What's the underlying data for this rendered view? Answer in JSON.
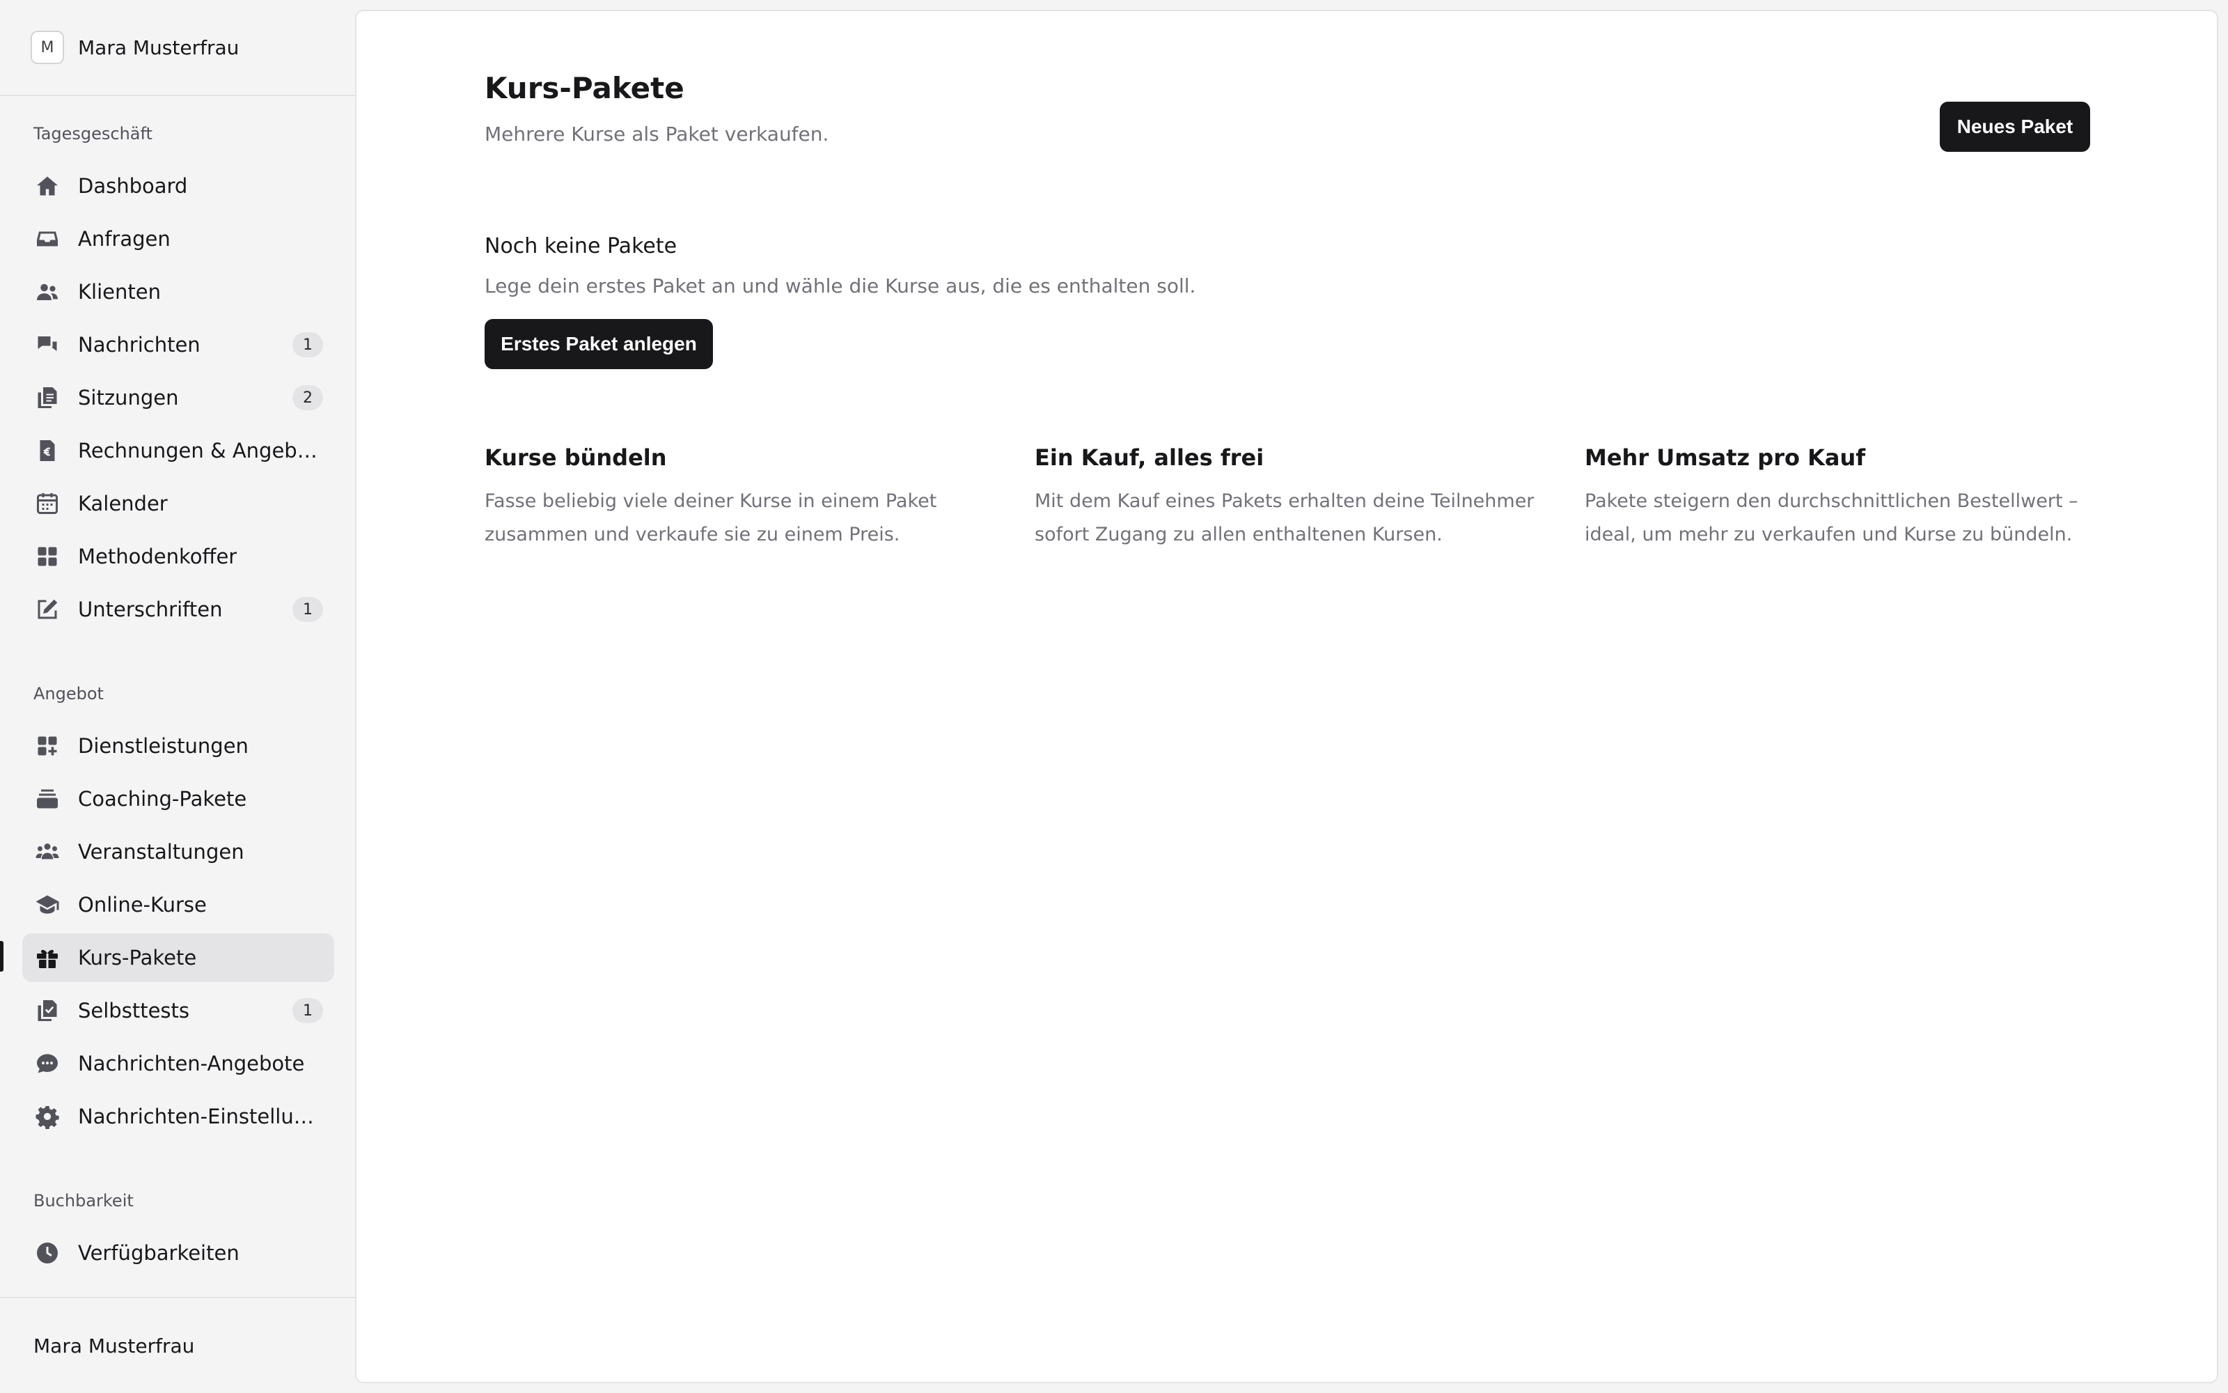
{
  "account": {
    "avatar_initial": "M",
    "name": "Mara Musterfrau"
  },
  "sidebar": {
    "groups": [
      {
        "label": "Tagesgeschäft"
      },
      {
        "label": "Angebot"
      },
      {
        "label": "Buchbarkeit"
      }
    ],
    "items": [
      {
        "label": "Dashboard",
        "icon": "home-icon"
      },
      {
        "label": "Anfragen",
        "icon": "inbox-icon"
      },
      {
        "label": "Klienten",
        "icon": "users-icon"
      },
      {
        "label": "Nachrichten",
        "icon": "chat-bubbles-icon",
        "badge": "1"
      },
      {
        "label": "Sitzungen",
        "icon": "documents-icon",
        "badge": "2"
      },
      {
        "label": "Rechnungen & Angebote",
        "icon": "euro-document-icon"
      },
      {
        "label": "Kalender",
        "icon": "calendar-icon"
      },
      {
        "label": "Methodenkoffer",
        "icon": "grid-icon"
      },
      {
        "label": "Unterschriften",
        "icon": "pencil-square-icon",
        "badge": "1"
      },
      {
        "label": "Dienstleistungen",
        "icon": "squares-plus-icon"
      },
      {
        "label": "Coaching-Pakete",
        "icon": "stack-icon"
      },
      {
        "label": "Veranstaltungen",
        "icon": "group-icon"
      },
      {
        "label": "Online-Kurse",
        "icon": "graduation-cap-icon"
      },
      {
        "label": "Kurs-Pakete",
        "icon": "gift-icon",
        "active": true
      },
      {
        "label": "Selbsttests",
        "icon": "checklist-icon",
        "badge": "1"
      },
      {
        "label": "Nachrichten-Angebote",
        "icon": "message-icon"
      },
      {
        "label": "Nachrichten-Einstellungen",
        "icon": "gear-icon"
      },
      {
        "label": "Verfügbarkeiten",
        "icon": "clock-icon"
      }
    ],
    "footer_name": "Mara Musterfrau"
  },
  "main": {
    "title": "Kurs-Pakete",
    "subtitle": "Mehrere Kurse als Paket verkaufen.",
    "new_button": "Neues Paket",
    "empty": {
      "title": "Noch keine Pakete",
      "text": "Lege dein erstes Paket an und wähle die Kurse aus, die es enthalten soll.",
      "button": "Erstes Paket anlegen"
    },
    "features": [
      {
        "title": "Kurse bündeln",
        "text": "Fasse beliebig viele deiner Kurse in einem Paket zusammen und verkaufe sie zu einem Preis."
      },
      {
        "title": "Ein Kauf, alles frei",
        "text": "Mit dem Kauf eines Pakets erhalten deine Teilnehmer sofort Zugang zu allen enthaltenen Kursen."
      },
      {
        "title": "Mehr Umsatz pro Kauf",
        "text": "Pakete steigern den durchschnittlichen Bestellwert – ideal, um mehr zu verkaufen und Kurse zu bündeln."
      }
    ]
  },
  "colors": {
    "accent": "#18181b",
    "sidebar_bg": "#f4f4f5",
    "muted_text": "#71717a"
  }
}
